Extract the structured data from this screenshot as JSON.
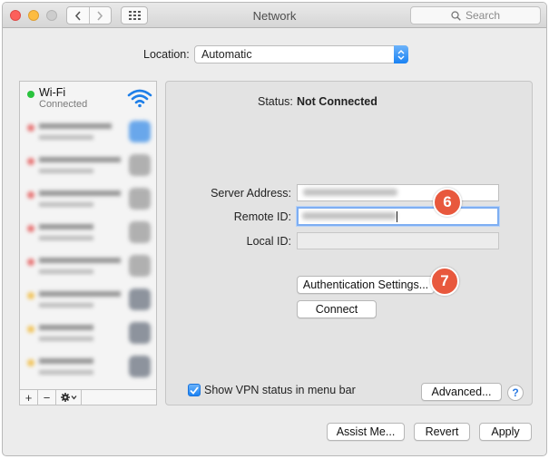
{
  "window": {
    "title": "Network"
  },
  "toolbar": {
    "back_icon": "chevron-left-icon",
    "forward_icon": "chevron-right-icon",
    "show_all_icon": "grid-icon",
    "search_placeholder": "Search"
  },
  "location": {
    "label": "Location:",
    "value": "Automatic"
  },
  "sidebar": {
    "items": [
      {
        "name": "Wi-Fi",
        "status": "Connected",
        "status_color": "#2ac33e",
        "icon": "wifi-icon"
      }
    ],
    "add_label": "+",
    "remove_label": "−",
    "actions_icon": "gear-icon"
  },
  "panel": {
    "status_label": "Status:",
    "status_value": "Not Connected",
    "server_address_label": "Server Address:",
    "remote_id_label": "Remote ID:",
    "local_id_label": "Local ID:",
    "auth_button": "Authentication Settings...",
    "connect_button": "Connect",
    "show_vpn_label": "Show VPN status in menu bar",
    "show_vpn_checked": true,
    "advanced_button": "Advanced...",
    "help_label": "?"
  },
  "callouts": {
    "step_6": "6",
    "step_7": "7",
    "color": "#e8583d"
  },
  "footer": {
    "assist_button": "Assist Me...",
    "revert_button": "Revert",
    "apply_button": "Apply"
  },
  "colors": {
    "accent": "#1a82f3",
    "window_bg": "#ececec"
  }
}
